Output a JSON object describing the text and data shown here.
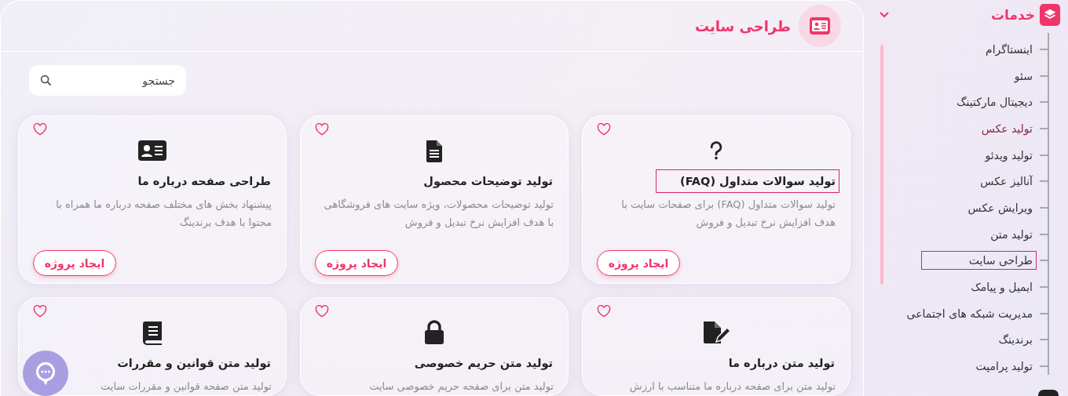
{
  "main": {
    "title": "طراحی سایت",
    "search": {
      "placeholder": "جستجو"
    },
    "cards": [
      {
        "kind": "question",
        "title": "تولید سوالات متداول (FAQ)",
        "outlined": true,
        "description": "تولید سوالات متداول (FAQ) برای صفحات سایت با هدف افزایش نرخ تبدیل و فروش",
        "button": "ایجاد پروژه",
        "favorite": false
      },
      {
        "kind": "document",
        "title": "تولید توضیحات محصول",
        "outlined": false,
        "description": "تولید توضیحات محصولات، ویژه سایت های فروشگاهی با هدف افزایش نرخ تبدیل و فروش",
        "button": "ایجاد پروژه",
        "favorite": false
      },
      {
        "kind": "id-card",
        "title": "طراحی صفحه درباره ما",
        "outlined": false,
        "description": "پیشنهاد بخش های مختلف صفحه درباره ما همراه با محتوا با هدف برندینگ",
        "button": "ایجاد پروژه",
        "favorite": false
      },
      {
        "kind": "file-pen",
        "title": "تولید متن درباره ما",
        "outlined": false,
        "description": "تولید متن برای صفحه درباره ما متناسب با ارزش",
        "favorite": false
      },
      {
        "kind": "lock",
        "title": "تولید متن حریم خصوصی",
        "outlined": false,
        "description": "تولید متن برای صفحه حریم خصوصی سایت",
        "favorite": false
      },
      {
        "kind": "book",
        "title": "تولید متن قوانین و مقررات",
        "outlined": false,
        "description": "تولید متن صفحه قوانین و مقررات سایت",
        "favorite": false
      }
    ]
  },
  "sidebar": {
    "title": "خدمات",
    "expanded": true,
    "items": [
      {
        "label": "اینستاگرام",
        "selected": false,
        "hovered": false
      },
      {
        "label": "سئو",
        "selected": false,
        "hovered": false
      },
      {
        "label": "دیجیتال مارکتینگ",
        "selected": false,
        "hovered": false
      },
      {
        "label": "تولید عکس",
        "selected": false,
        "hovered": true
      },
      {
        "label": "تولید ویدئو",
        "selected": false,
        "hovered": false
      },
      {
        "label": "آنالیز عکس",
        "selected": false,
        "hovered": false
      },
      {
        "label": "ویرایش عکس",
        "selected": false,
        "hovered": false
      },
      {
        "label": "تولید متن",
        "selected": false,
        "hovered": false
      },
      {
        "label": "طراحی سایت",
        "selected": true,
        "hovered": false
      },
      {
        "label": "ایمیل و پیامک",
        "selected": false,
        "hovered": false
      },
      {
        "label": "مدیریت شبکه های اجتماعی",
        "selected": false,
        "hovered": false
      },
      {
        "label": "برندینگ",
        "selected": false,
        "hovered": false
      },
      {
        "label": "تولید پرامپت",
        "selected": false,
        "hovered": false
      }
    ]
  }
}
